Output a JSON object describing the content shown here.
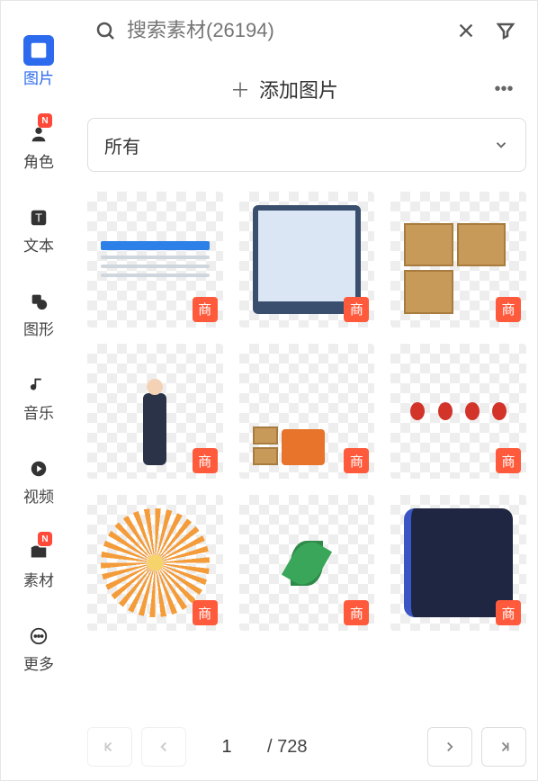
{
  "sidebar": {
    "items": [
      {
        "label": "图片",
        "icon": "image-icon",
        "active": true,
        "notif": null
      },
      {
        "label": "角色",
        "icon": "avatar-icon",
        "active": false,
        "notif": "N"
      },
      {
        "label": "文本",
        "icon": "text-icon",
        "active": false,
        "notif": null
      },
      {
        "label": "图形",
        "icon": "shapes-icon",
        "active": false,
        "notif": null
      },
      {
        "label": "音乐",
        "icon": "music-icon",
        "active": false,
        "notif": null
      },
      {
        "label": "视频",
        "icon": "video-icon",
        "active": false,
        "notif": null
      },
      {
        "label": "素材",
        "icon": "folder-icon",
        "active": false,
        "notif": "N"
      },
      {
        "label": "更多",
        "icon": "more-icon",
        "active": false,
        "notif": null
      }
    ]
  },
  "search": {
    "placeholder": "搜索素材(26194)",
    "value": ""
  },
  "toolbar": {
    "add_label": "添加图片"
  },
  "filter": {
    "selected": "所有"
  },
  "assets": {
    "badge": "商",
    "items": [
      {
        "name": "document-illustration"
      },
      {
        "name": "monitor-illustration"
      },
      {
        "name": "boxes-illustration"
      },
      {
        "name": "person-clipboard-illustration"
      },
      {
        "name": "forklift-illustration"
      },
      {
        "name": "lanterns-illustration"
      },
      {
        "name": "firework-illustration"
      },
      {
        "name": "leaves-illustration"
      },
      {
        "name": "dark-frame-illustration"
      }
    ]
  },
  "pager": {
    "current": "1",
    "total_prefix": "/ ",
    "total": "728"
  }
}
